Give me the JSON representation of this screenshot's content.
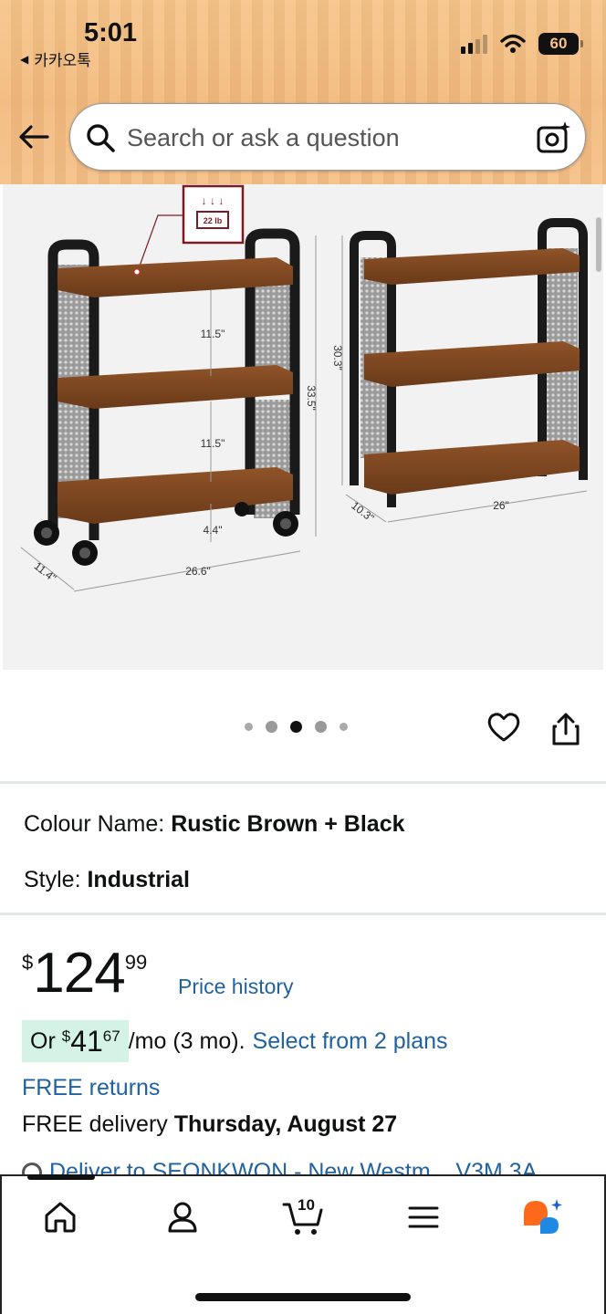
{
  "status_bar": {
    "time": "5:01",
    "back_app": "카카오톡",
    "battery": "60"
  },
  "search": {
    "placeholder": "Search or ask a question"
  },
  "image": {
    "badge": "22 lb",
    "cart": {
      "h1": "11.5\"",
      "h2": "11.5\"",
      "h3": "4.4\"",
      "height": "33.5\"",
      "depth": "11.4\"",
      "width": "26.6\""
    },
    "shelf": {
      "height": "30.3\"",
      "depth": "10.3\"",
      "width": "26\""
    }
  },
  "carousel": {
    "count": 5,
    "active": 2
  },
  "variations": {
    "colour_label": "Colour Name:",
    "colour_value": "Rustic Brown + Black",
    "style_label": "Style:",
    "style_value": "Industrial"
  },
  "price": {
    "currency": "$",
    "whole": "124",
    "fraction": "99",
    "history_link": "Price history"
  },
  "installment": {
    "prefix": "Or",
    "currency": "$",
    "whole": "41",
    "fraction": "67",
    "suffix": "/mo (3 mo).",
    "link": "Select from 2 plans"
  },
  "delivery": {
    "free_returns": "FREE returns",
    "prefix": "FREE delivery",
    "date": "Thursday, August 27",
    "deliver_to": "Deliver to SEONKWON - New Westm... V3M 3A"
  },
  "tabbar": {
    "cart_count": "10"
  },
  "colors": {
    "header": "#f4bd82",
    "link": "#2162a1",
    "install_bg": "#d4f2e5",
    "rust": "#7a4420",
    "ai_orange": "#ff6a1a",
    "ai_blue": "#1e88e5"
  }
}
